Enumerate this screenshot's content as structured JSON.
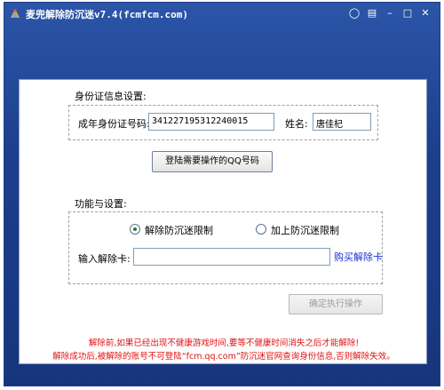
{
  "window": {
    "title": "麦兜解除防沉迷v7.4(fcmfcm.com)",
    "controls": {
      "feedback": "◯",
      "menu": "▤",
      "minimize": "–",
      "maximize": "□",
      "close": "✕"
    }
  },
  "id_section": {
    "heading": "身份证信息设置:",
    "id_label": "成年身份证号码:",
    "id_value": "341227195312240015",
    "name_label": "姓名:",
    "name_value": "唐佳杞",
    "login_button": "登陆需要操作的QQ号码"
  },
  "function_section": {
    "heading": "功能与设置:",
    "options": [
      {
        "label": "解除防沉迷限制",
        "checked": true
      },
      {
        "label": "加上防沉迷限制",
        "checked": false
      }
    ],
    "card_label": "输入解除卡:",
    "card_value": "",
    "buy_link": "购买解除卡"
  },
  "execute_button": "确定执行操作",
  "notices": [
    "解除前,如果已经出现不健康游戏时间,要等不健康时间消失之后才能解除!",
    "解除成功后,被解除的账号不可登陆“fcm.qq.com”防沉迷官网查询身份信息,否则解除失效。"
  ],
  "colors": {
    "title_bg": "#1c3f8d",
    "notice_red": "#e01010",
    "link_blue": "#1a2fd8"
  }
}
